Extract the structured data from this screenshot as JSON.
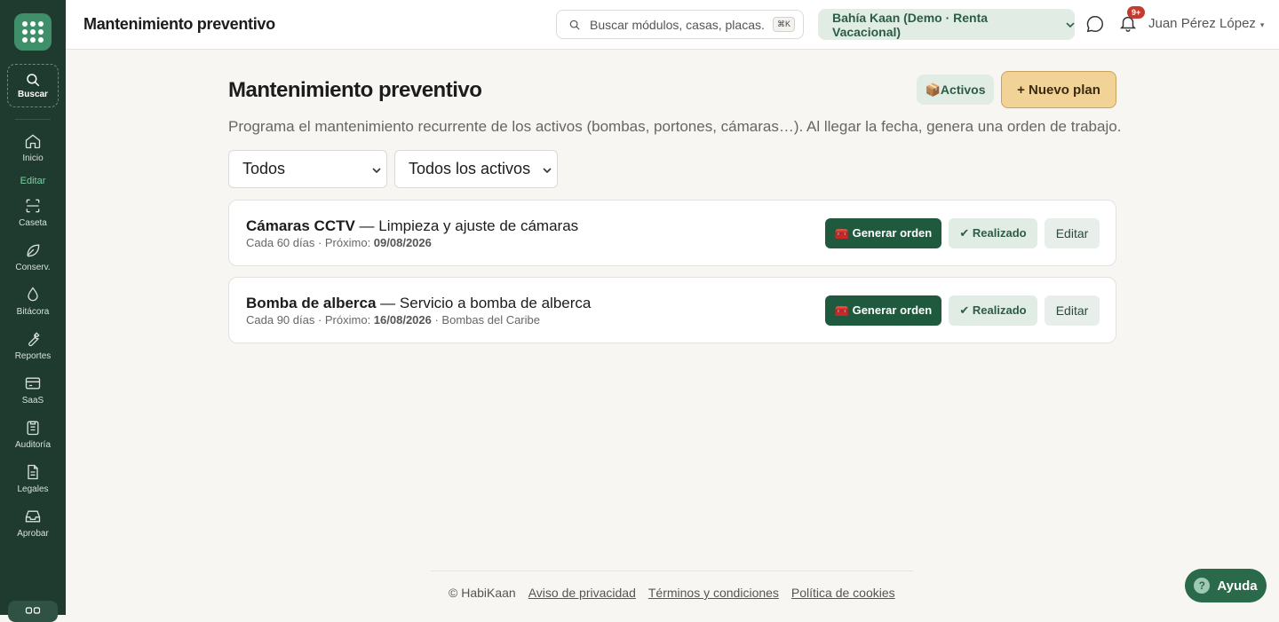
{
  "header": {
    "title": "Mantenimiento preventivo",
    "search_placeholder": "Buscar módulos, casas, placas...",
    "search_shortcut": "⌘K",
    "tenant": "Bahía Kaan (Demo · Renta Vacacional)",
    "notifications_badge": "9+",
    "user": "Juan Pérez López"
  },
  "sidebar": {
    "search_label": "Buscar",
    "section_label": "Editar",
    "items": [
      {
        "label": "Inicio",
        "icon": "home-icon"
      },
      {
        "label": "Caseta",
        "icon": "scan-icon"
      },
      {
        "label": "Conserv.",
        "icon": "leaf-icon"
      },
      {
        "label": "Bitácora",
        "icon": "drop-icon"
      },
      {
        "label": "Reportes",
        "icon": "wrench-icon"
      },
      {
        "label": "SaaS",
        "icon": "card-icon"
      },
      {
        "label": "Auditoría",
        "icon": "clipboard-icon"
      },
      {
        "label": "Legales",
        "icon": "document-icon"
      },
      {
        "label": "Aprobar",
        "icon": "inbox-icon"
      }
    ]
  },
  "main": {
    "title": "Mantenimiento preventivo",
    "assets_button": "📦Activos",
    "new_plan_button": "+ Nuevo plan",
    "subtitle": "Programa el mantenimiento recurrente de los activos (bombas, portones, cámaras…). Al llegar la fecha, genera una orden de trabajo.",
    "filter_status": "Todos",
    "filter_assets": "Todos los activos",
    "plans": [
      {
        "asset": "Cámaras CCTV",
        "task": " — Limpieza y ajuste de cámaras",
        "frequency": "Cada 60 días · Próximo: ",
        "next_date": "09/08/2026",
        "provider": ""
      },
      {
        "asset": "Bomba de alberca",
        "task": " — Servicio a bomba de alberca",
        "frequency": "Cada 90 días · Próximo: ",
        "next_date": "16/08/2026",
        "provider": " · Bombas del Caribe"
      }
    ],
    "generate_button": "🧰 Generar orden",
    "done_button": "✔ Realizado",
    "edit_button": "Editar"
  },
  "footer": {
    "copyright": "© HabiKaan",
    "privacy": "Aviso de privacidad",
    "terms": "Términos y condiciones",
    "cookies": "Política de cookies"
  },
  "help_button": "Ayuda",
  "colors": {
    "sidebar_bg": "#1f3a2f",
    "primary": "#1f5a3e",
    "accent": "#f1d398",
    "soft_green": "#e1ede4"
  }
}
